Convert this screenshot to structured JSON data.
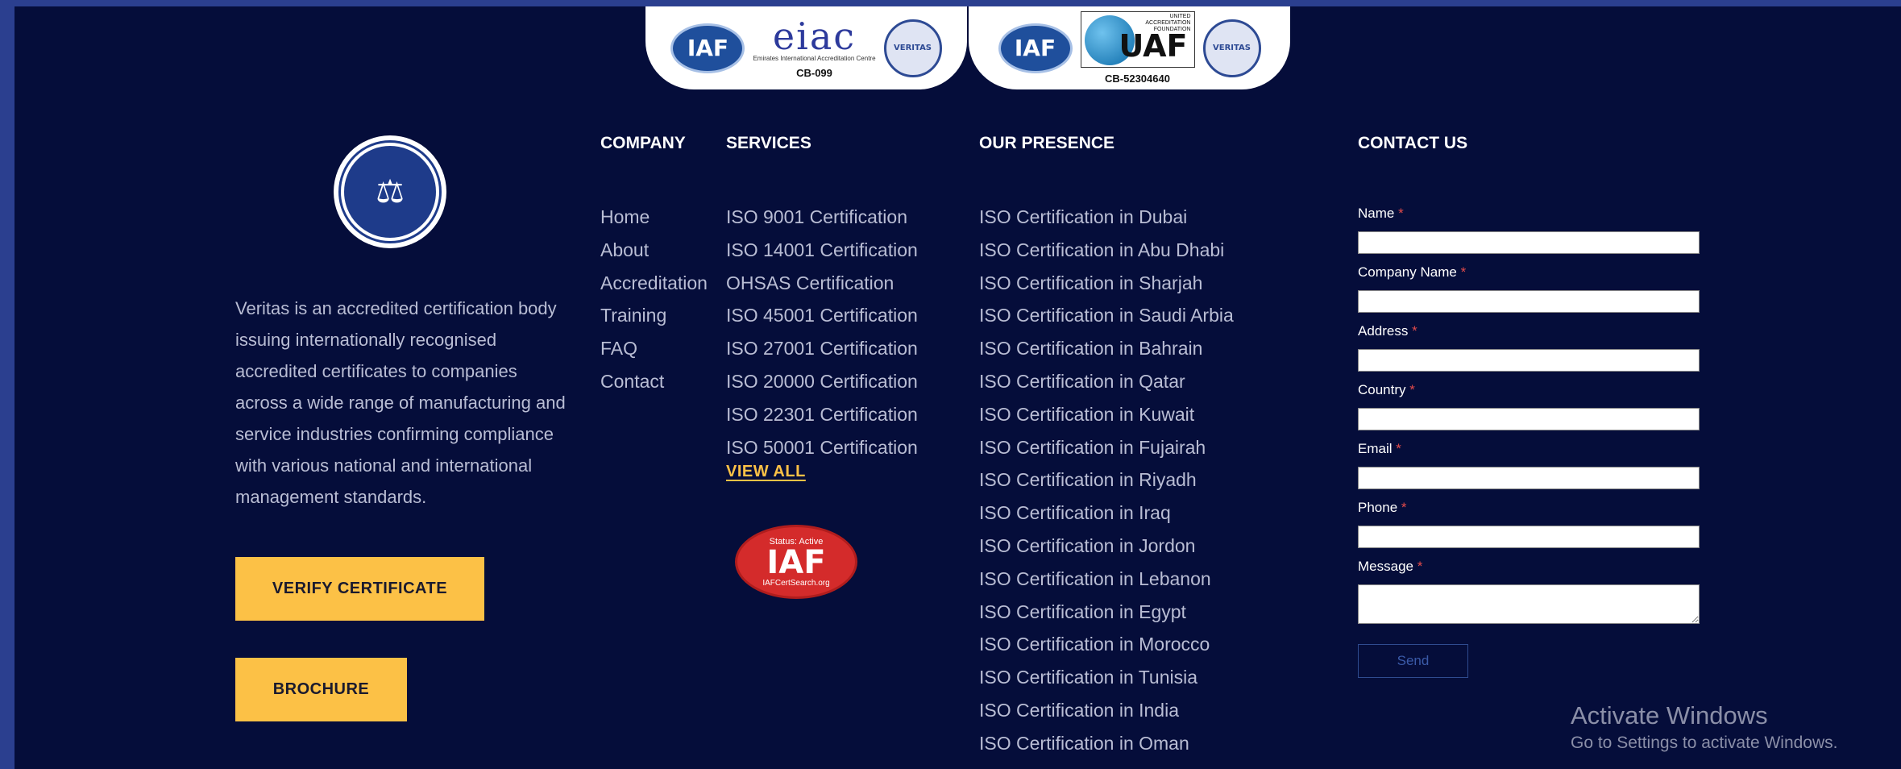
{
  "badges": [
    {
      "logo_text": "eiac",
      "subtitle": "Emirates International Accreditation Centre",
      "code": "CB-099"
    },
    {
      "logo_text": "UAF",
      "caption": "UNITED ACCREDITATION FOUNDATION",
      "code": "CB-52304640"
    }
  ],
  "seal_texts": {
    "iaf": "IAF",
    "veritas": "VERITAS"
  },
  "about": {
    "text": "Veritas is an accredited certification body issuing internationally recognised accredited certificates to companies across a wide range of manufacturing and service industries confirming compliance with various national and international management standards.",
    "verify_label": "VERIFY CERTIFICATE",
    "brochure_label": "BROCHURE"
  },
  "company": {
    "heading": "COMPANY",
    "items": [
      "Home",
      "About",
      "Accreditation",
      "Training",
      "FAQ",
      "Contact"
    ]
  },
  "services": {
    "heading": "SERVICES",
    "items": [
      "ISO 9001 Certification",
      "ISO 14001 Certification",
      "OHSAS Certification",
      "ISO 45001 Certification",
      "ISO 27001 Certification",
      "ISO 20000 Certification",
      "ISO 22301 Certification",
      "ISO 50001 Certification"
    ],
    "view_all": "VIEW ALL",
    "iaf_status": "Status: Active",
    "iaf_big": "IAF",
    "iaf_site": "IAFCertSearch.org"
  },
  "presence": {
    "heading": "OUR PRESENCE",
    "items": [
      "ISO Certification in Dubai",
      "ISO Certification in Abu Dhabi",
      "ISO Certification in Sharjah",
      "ISO Certification in Saudi Arbia",
      "ISO Certification in Bahrain",
      "ISO Certification in Qatar",
      "ISO Certification in Kuwait",
      "ISO Certification in Fujairah",
      "ISO Certification in Riyadh",
      "ISO Certification in Iraq",
      "ISO Certification in Jordon",
      "ISO Certification in Lebanon",
      "ISO Certification in Egypt",
      "ISO Certification in Morocco",
      "ISO Certification in Tunisia",
      "ISO Certification in India",
      "ISO Certification in Oman"
    ]
  },
  "contact": {
    "heading": "CONTACT US",
    "fields": [
      {
        "label": "Name",
        "value": ""
      },
      {
        "label": "Company Name",
        "value": ""
      },
      {
        "label": "Address",
        "value": ""
      },
      {
        "label": "Country",
        "value": ""
      },
      {
        "label": "Email",
        "value": ""
      },
      {
        "label": "Phone",
        "value": ""
      }
    ],
    "message_label": "Message",
    "required_mark": "*",
    "send_label": "Send"
  },
  "watermark": {
    "title": "Activate Windows",
    "subtitle": "Go to Settings to activate Windows."
  }
}
